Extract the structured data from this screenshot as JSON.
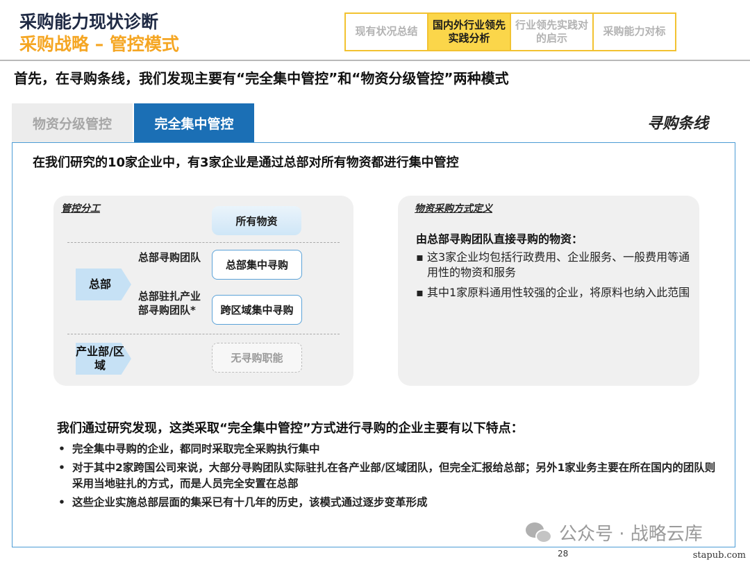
{
  "header": {
    "title": "采购能力现状诊断",
    "subtitle": "采购战略 – 管控模式",
    "nav": [
      {
        "label": "现有状况总结",
        "active": false
      },
      {
        "label": "国内外行业领先实践分析",
        "active": true
      },
      {
        "label": "行业领先实践对的启示",
        "active": false
      },
      {
        "label": "采购能力对标",
        "active": false
      }
    ]
  },
  "headline": "首先，在寻购条线，我们发现主要有“完全集中管控”和“物资分级管控”两种模式",
  "tabs": {
    "inactive": "物资分级管控",
    "active": "完全集中管控",
    "line_label": "寻购条线"
  },
  "intro": "在我们研究的10家企业中，有3家企业是通过总部对所有物资都进行集中管控",
  "diagram": {
    "panel_label": "管控分工",
    "top_pill": "所有物资",
    "hq": "总部",
    "hq_team": "总部寻购团队",
    "hq_box": "总部集中寻购",
    "stationed_team": "总部驻扎产业部寻购团队*",
    "stationed_box": "跨区域集中寻购",
    "division": "产业部/区域",
    "division_box": "无寻购职能"
  },
  "definition": {
    "panel_label": "物资采购方式定义",
    "heading": "由总部寻购团队直接寻购的物资：",
    "items": [
      "这3家企业均包括行政费用、企业服务、一般费用等通用性的物资和服务",
      "其中1家原料通用性较强的企业，将原料也纳入此范围"
    ]
  },
  "findings": {
    "heading": "我们通过研究发现，这类采取“完全集中管控”方式进行寻购的企业主要有以下特点：",
    "items": [
      "完全集中寻购的企业，都同时采取完全采购执行集中",
      "对于其中2家跨国公司来说，大部分寻购团队实际驻扎在各产业部/区域团队，但完全汇报给总部；另外1家业务主要在所在国内的团队则采用当地驻扎的方式，而是人员完全安置在总部",
      "这些企业实施总部层面的集采已有十几年的历史，该模式通过逐步变革形成"
    ]
  },
  "watermark": "公众号 · 战略云库",
  "page_number": "28",
  "site": "stapub.com",
  "colors": {
    "accent_orange": "#f5a623",
    "nav_border": "#f2c230",
    "nav_active": "#fbd64a",
    "tab_active": "#1b6fb5",
    "box_border": "#4a9bd5"
  }
}
